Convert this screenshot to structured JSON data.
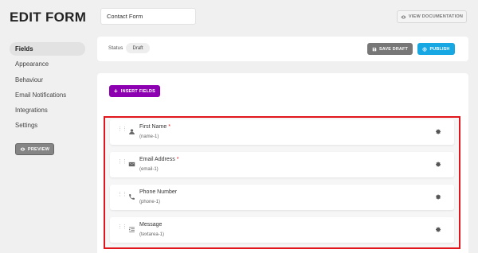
{
  "header": {
    "title": "EDIT FORM",
    "form_name": "Contact Form",
    "documentation_label": "VIEW DOCUMENTATION"
  },
  "sidebar": {
    "items": [
      {
        "label": "Fields",
        "active": true
      },
      {
        "label": "Appearance"
      },
      {
        "label": "Behaviour"
      },
      {
        "label": "Email Notifications"
      },
      {
        "label": "Integrations"
      },
      {
        "label": "Settings"
      }
    ],
    "preview_label": "PREVIEW"
  },
  "status_bar": {
    "status_label": "Status",
    "status_value": "Draft",
    "save_draft_label": "SAVE DRAFT",
    "publish_label": "PUBLISH"
  },
  "fields_panel": {
    "insert_label": "INSERT FIELDS",
    "fields": [
      {
        "name": "First Name",
        "required": "*",
        "id": "(name-1)",
        "icon": "user-icon"
      },
      {
        "name": "Email Address",
        "required": "*",
        "id": "(email-1)",
        "icon": "envelope-icon"
      },
      {
        "name": "Phone Number",
        "required": "",
        "id": "(phone-1)",
        "icon": "phone-icon"
      },
      {
        "name": "Message",
        "required": "",
        "id": "(textarea-1)",
        "icon": "text-lines-icon"
      }
    ]
  },
  "colors": {
    "publish": "#17a8e3",
    "insert": "#8d00b1",
    "highlight": "#e0161c",
    "save_draft": "#777777"
  }
}
